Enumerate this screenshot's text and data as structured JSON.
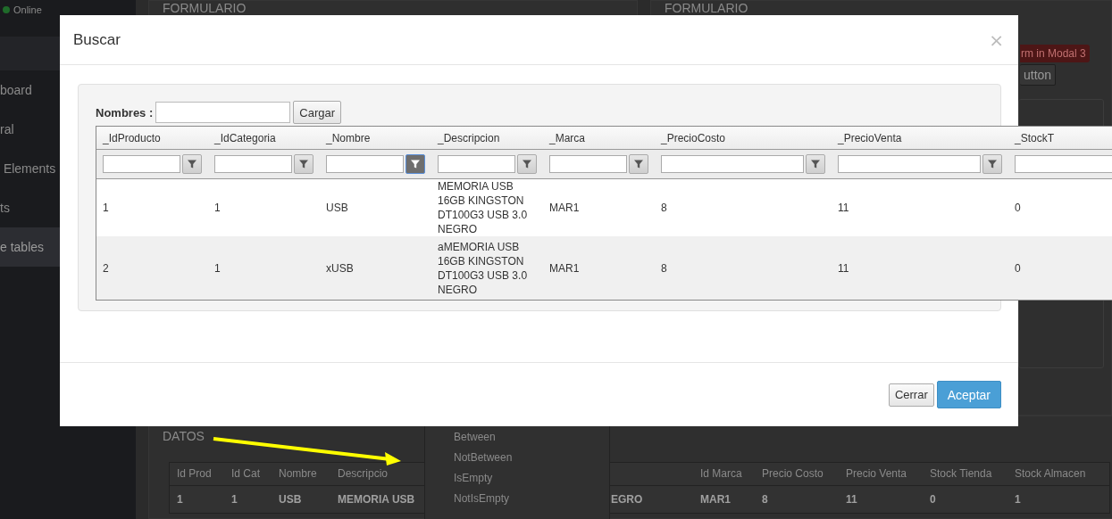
{
  "sidebar": {
    "status": "Online",
    "items": [
      {
        "label": "board",
        "selected": false
      },
      {
        "label": "ral",
        "selected": false
      },
      {
        "label": " Elements",
        "selected": false
      },
      {
        "label": "ts",
        "selected": false
      },
      {
        "label": "e tables",
        "selected": true
      }
    ]
  },
  "panels": [
    {
      "title": "FORMULARIO"
    },
    {
      "title": "FORMULARIO",
      "badge": "rm in Modal 3",
      "button": "utton"
    }
  ],
  "datos": {
    "title": "DATOS",
    "columns": [
      "Id Prod",
      "Id Cat",
      "Nombre",
      "Descripcio",
      "",
      "",
      "Id Marca",
      "Precio Costo",
      "Precio Venta",
      "Stock Tienda",
      "Stock Almacen"
    ],
    "rows": [
      [
        "1",
        "1",
        "USB",
        "MEMORIA USB",
        "",
        "EGRO",
        "MAR1",
        "8",
        "11",
        "0",
        "1"
      ]
    ],
    "filter_menu": [
      "Between",
      "NotBetween",
      "IsEmpty",
      "NotIsEmpty"
    ]
  },
  "modal": {
    "title": "Buscar",
    "close": "×",
    "search_label": "Nombres :",
    "search_button": "Cargar",
    "columns": [
      {
        "label": "_IdProducto",
        "filter_active": false
      },
      {
        "label": "_IdCategoria",
        "filter_active": false
      },
      {
        "label": "_Nombre",
        "filter_active": true
      },
      {
        "label": "_Descripcion",
        "filter_active": false
      },
      {
        "label": "_Marca",
        "filter_active": false
      },
      {
        "label": "_PrecioCosto",
        "filter_active": false
      },
      {
        "label": "_PrecioVenta",
        "filter_active": false
      },
      {
        "label": "_StockT"
      }
    ],
    "rows": [
      [
        "1",
        "1",
        "USB",
        "MEMORIA USB 16GB KINGSTON DT100G3 USB 3.0 NEGRO",
        "MAR1",
        "8",
        "11",
        "0"
      ],
      [
        "2",
        "1",
        "xUSB",
        "aMEMORIA USB 16GB KINGSTON DT100G3 USB 3.0 NEGRO",
        "MAR1",
        "8",
        "11",
        "0"
      ]
    ],
    "buttons": [
      {
        "label": "Cerrar",
        "kind": "default"
      },
      {
        "label": "Aceptar",
        "kind": "primary"
      }
    ]
  }
}
